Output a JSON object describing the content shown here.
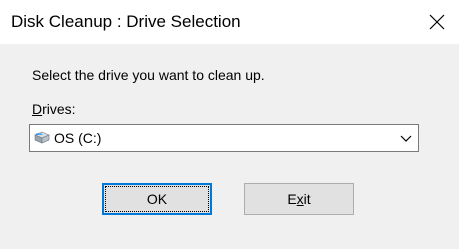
{
  "window": {
    "title": "Disk Cleanup : Drive Selection"
  },
  "dialog": {
    "prompt": "Select the drive you want to clean up.",
    "drives_label_mnemonic": "D",
    "drives_label_rest": "rives:",
    "selected_drive": "OS (C:)",
    "drive_icon": "hard-drive-icon"
  },
  "buttons": {
    "ok_label": "OK",
    "exit_mnemonic_prefix": "E",
    "exit_mnemonic": "x",
    "exit_suffix": "it"
  },
  "colors": {
    "focus_border": "#0078d7",
    "button_face": "#e1e1e1",
    "dialog_background": "#f0f0f0"
  }
}
